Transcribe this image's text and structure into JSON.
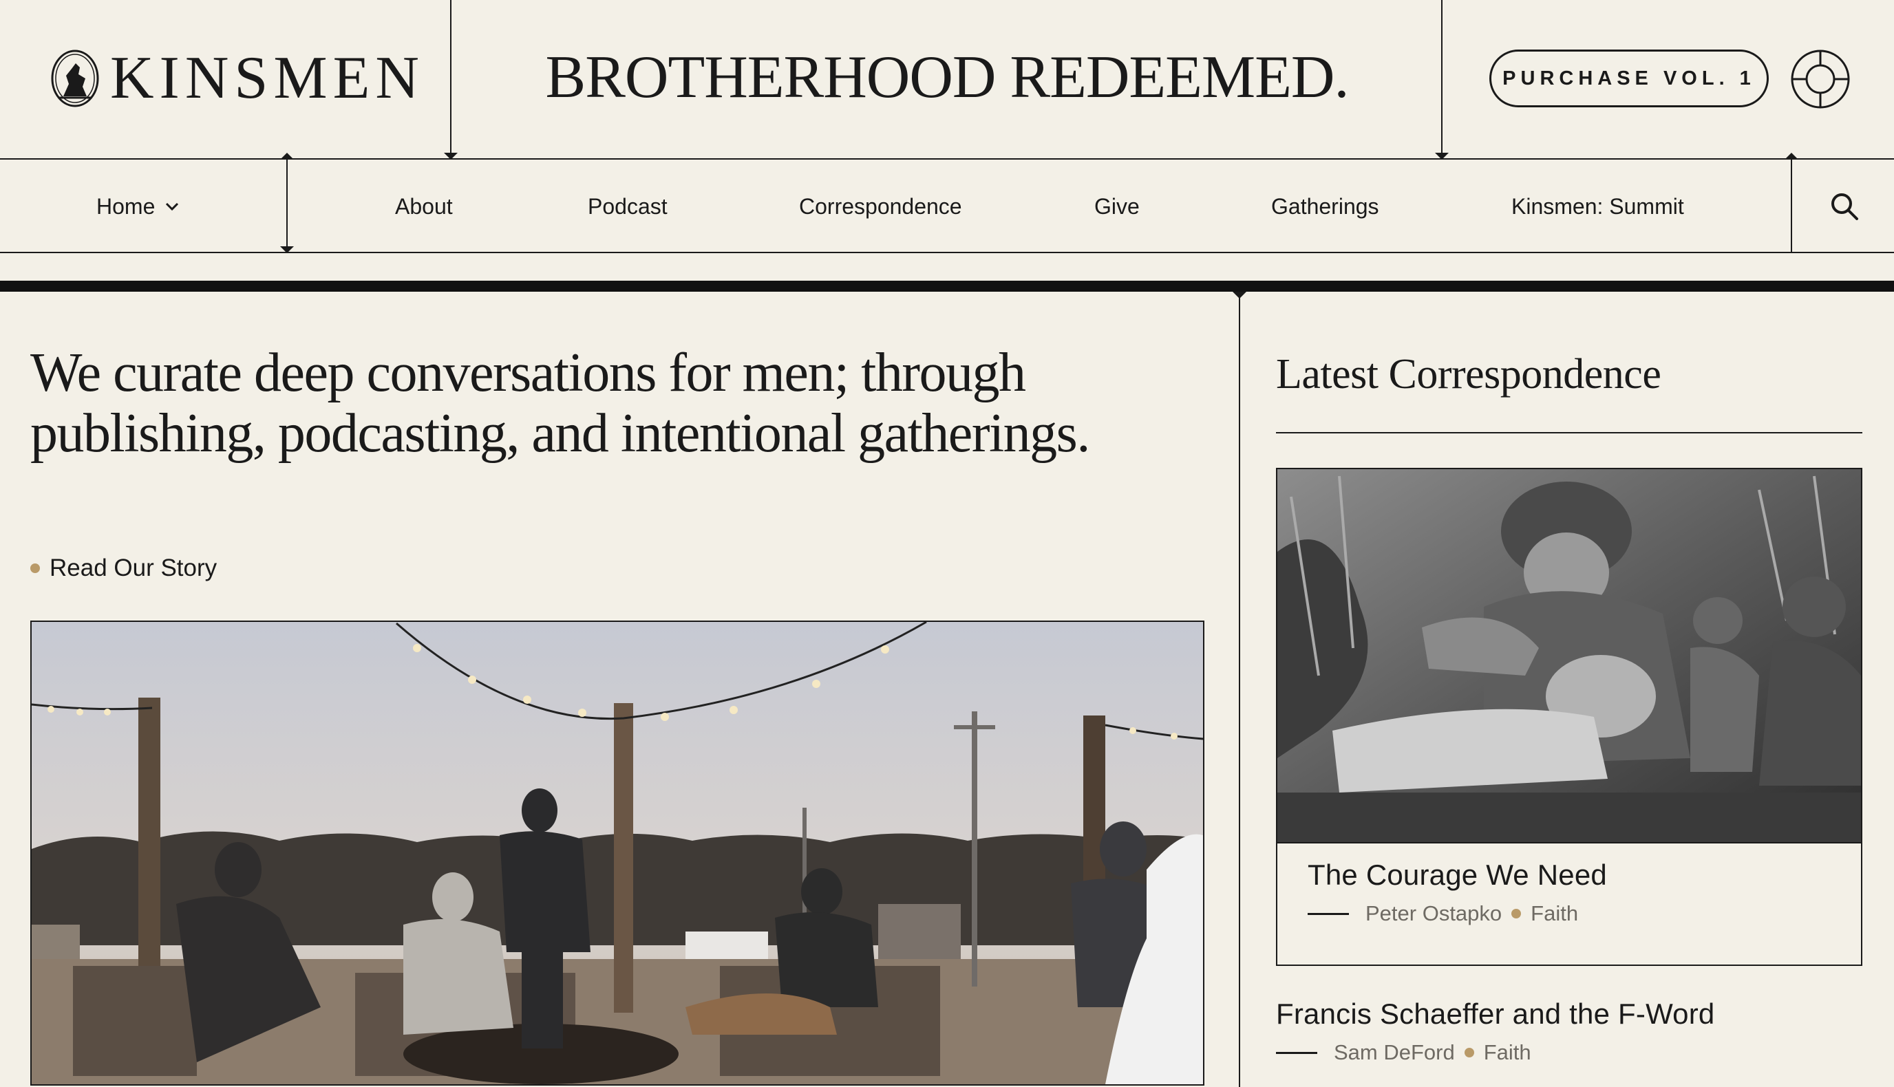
{
  "brand": {
    "name": "KINSMEN"
  },
  "header": {
    "tagline": "BROTHERHOOD REDEEMED.",
    "purchase_label": "PURCHASE VOL. 1"
  },
  "nav": {
    "home": "Home",
    "items": [
      "About",
      "Podcast",
      "Correspondence",
      "Give",
      "Gatherings",
      "Kinsmen: Summit"
    ]
  },
  "main": {
    "headline": "We curate deep conversations for men; through publishing, podcasting, and intentional gatherings.",
    "cta": "Read Our Story"
  },
  "sidebar": {
    "title": "Latest Correspondence",
    "articles": [
      {
        "title": "The Courage We Need",
        "author": "Peter Ostapko",
        "category": "Faith"
      },
      {
        "title": "Francis Schaeffer and the F-Word",
        "author": "Sam DeFord",
        "category": "Faith"
      }
    ]
  },
  "colors": {
    "background": "#f3f0e7",
    "ink": "#1a1a1a",
    "accent_dot": "#b99a68"
  }
}
